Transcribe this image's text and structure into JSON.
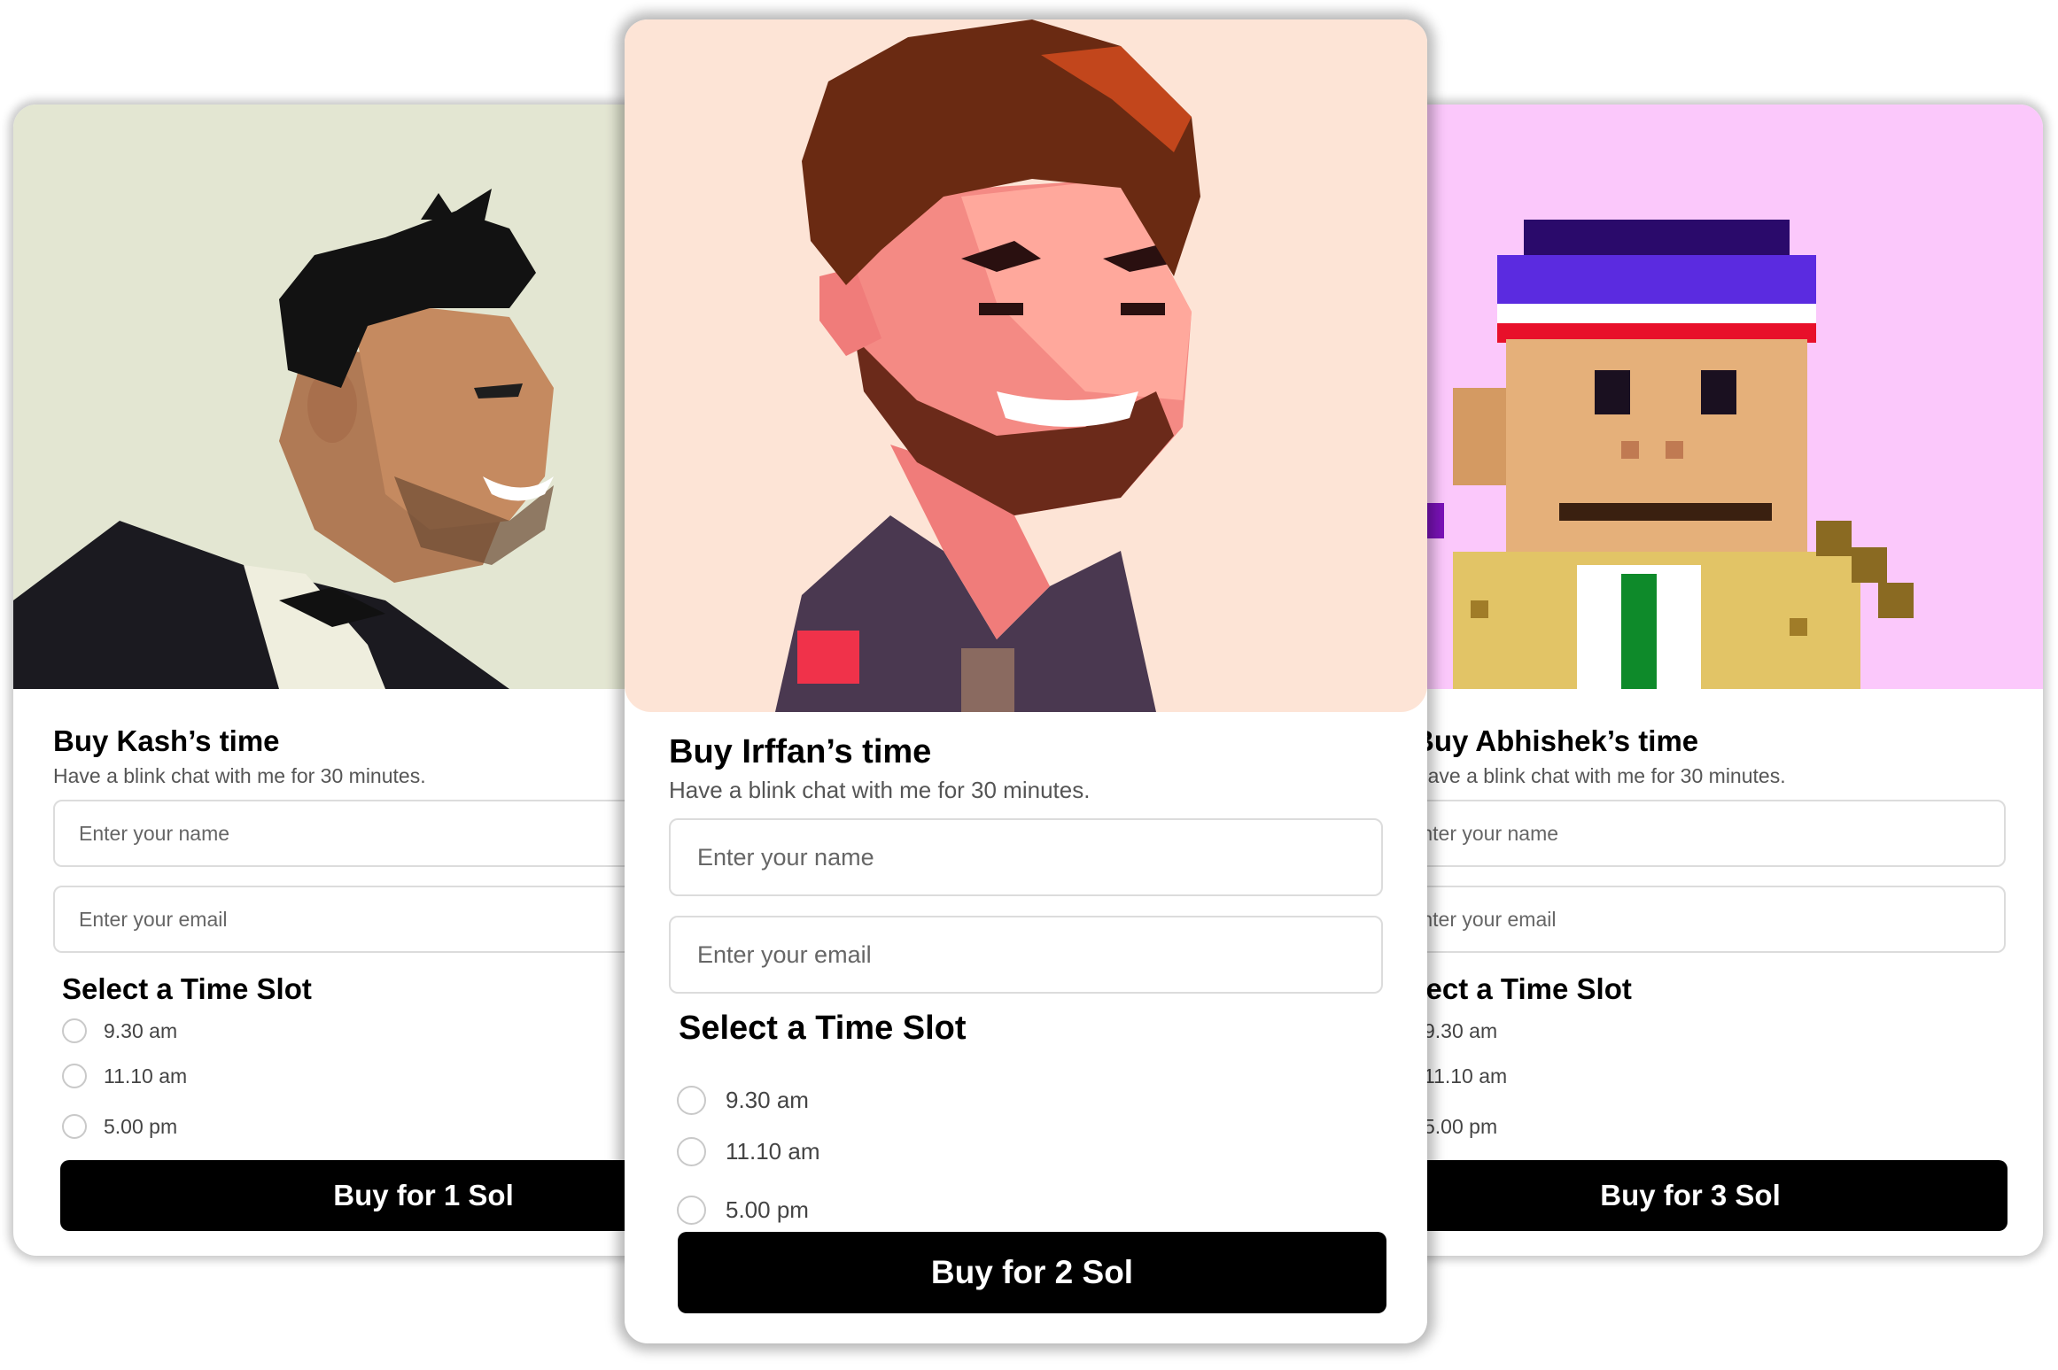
{
  "cards": {
    "left": {
      "title": "Buy Kash’s time",
      "subtitle": "Have a blink chat with me for 30 minutes.",
      "name_placeholder": "Enter your name",
      "email_placeholder": "Enter your email",
      "section_title": "Select a Time Slot",
      "slots": [
        "9.30 am",
        "11.10 am",
        "5.00 pm"
      ],
      "button_label": "Buy for 1 Sol",
      "avatar_background": "#e3e6d2"
    },
    "center": {
      "title": "Buy Irffan’s time",
      "subtitle": "Have a blink chat with me for 30 minutes.",
      "name_placeholder": "Enter your name",
      "email_placeholder": "Enter your email",
      "section_title": "Select a Time Slot",
      "slots": [
        "9.30 am",
        "11.10 am",
        "5.00 pm"
      ],
      "button_label": "Buy for 2 Sol",
      "avatar_background": "#fde4d6"
    },
    "right": {
      "title": "Buy Abhishek’s time",
      "subtitle": "Have a blink chat with me for 30 minutes.",
      "name_placeholder": "Enter your name",
      "email_placeholder": "Enter your email",
      "section_title": "Select a Time Slot",
      "slots": [
        "9.30 am",
        "11.10 am",
        "5.00 pm"
      ],
      "button_label": "Buy for 3 Sol",
      "avatar_background": "#fbc8fb"
    }
  },
  "colors": {
    "button": "#000000",
    "button_text": "#ffffff",
    "field_border": "#dcdcdc"
  }
}
